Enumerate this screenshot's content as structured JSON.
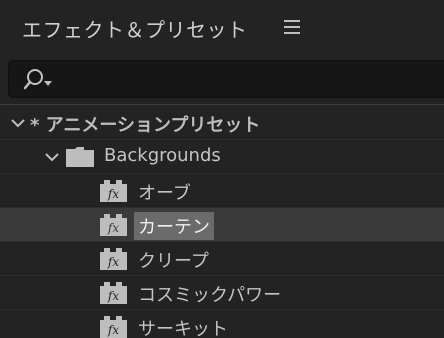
{
  "panel": {
    "title": "エフェクト＆プリセット"
  },
  "search": {
    "value": "",
    "placeholder": ""
  },
  "tree": {
    "root": {
      "label": "* アニメーションプリセット",
      "expanded": true
    },
    "folder": {
      "label": "Backgrounds",
      "expanded": true
    },
    "items": [
      {
        "label": "オーブ",
        "selected": false
      },
      {
        "label": "カーテン",
        "selected": true
      },
      {
        "label": "クリープ",
        "selected": false
      },
      {
        "label": "コスミックパワー",
        "selected": false
      },
      {
        "label": "サーキット",
        "selected": false
      }
    ]
  },
  "colors": {
    "background": "#232323",
    "selected_row": "#3a3a3a",
    "selected_label": "#6b6b6b",
    "icon": "#bdbdbd"
  },
  "icons": {
    "menu": "hamburger-menu-icon",
    "search": "search-icon",
    "expand": "chevron-down-icon",
    "folder": "folder-icon",
    "preset": "fx-preset-icon"
  }
}
